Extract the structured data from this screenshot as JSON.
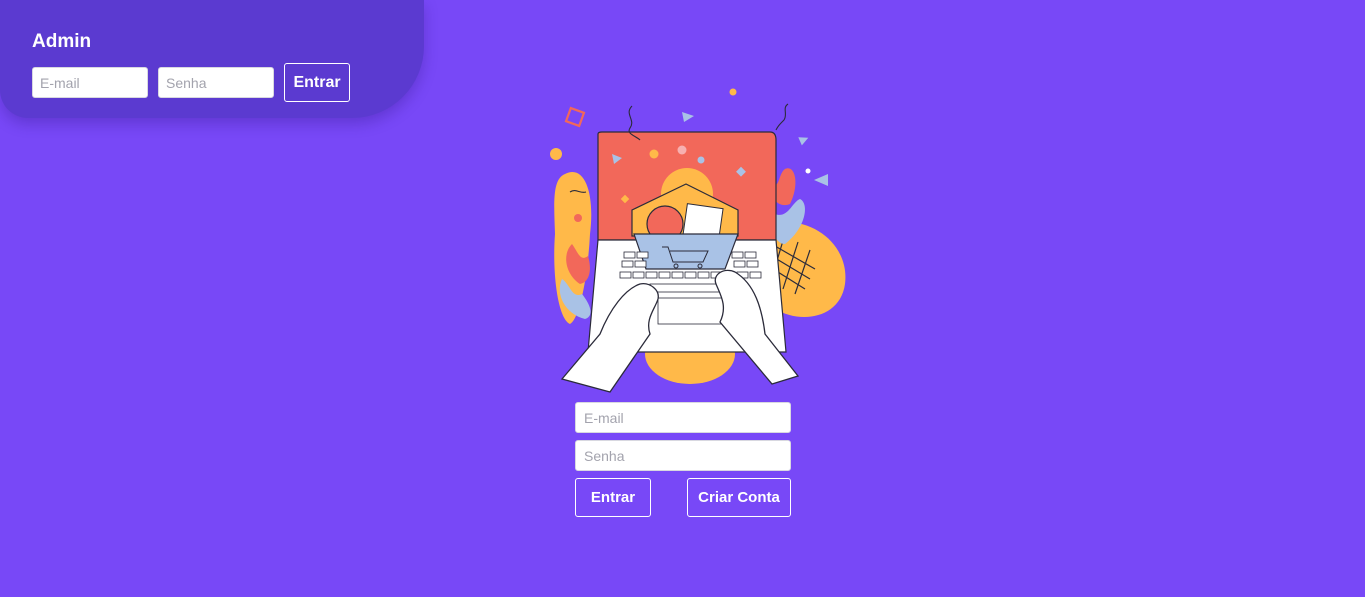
{
  "admin": {
    "title": "Admin",
    "email_placeholder": "E-mail",
    "password_placeholder": "Senha",
    "login_label": "Entrar"
  },
  "login": {
    "email_placeholder": "E-mail",
    "password_placeholder": "Senha",
    "login_label": "Entrar",
    "create_account_label": "Criar Conta"
  },
  "illustration": {
    "name": "laptop-shopping-illustration",
    "colors": {
      "background": "#7848f7",
      "coral": "#f2685a",
      "yellow": "#ffb949",
      "light_blue": "#a9c2e6",
      "white": "#ffffff",
      "outline": "#2b2b3a"
    }
  }
}
